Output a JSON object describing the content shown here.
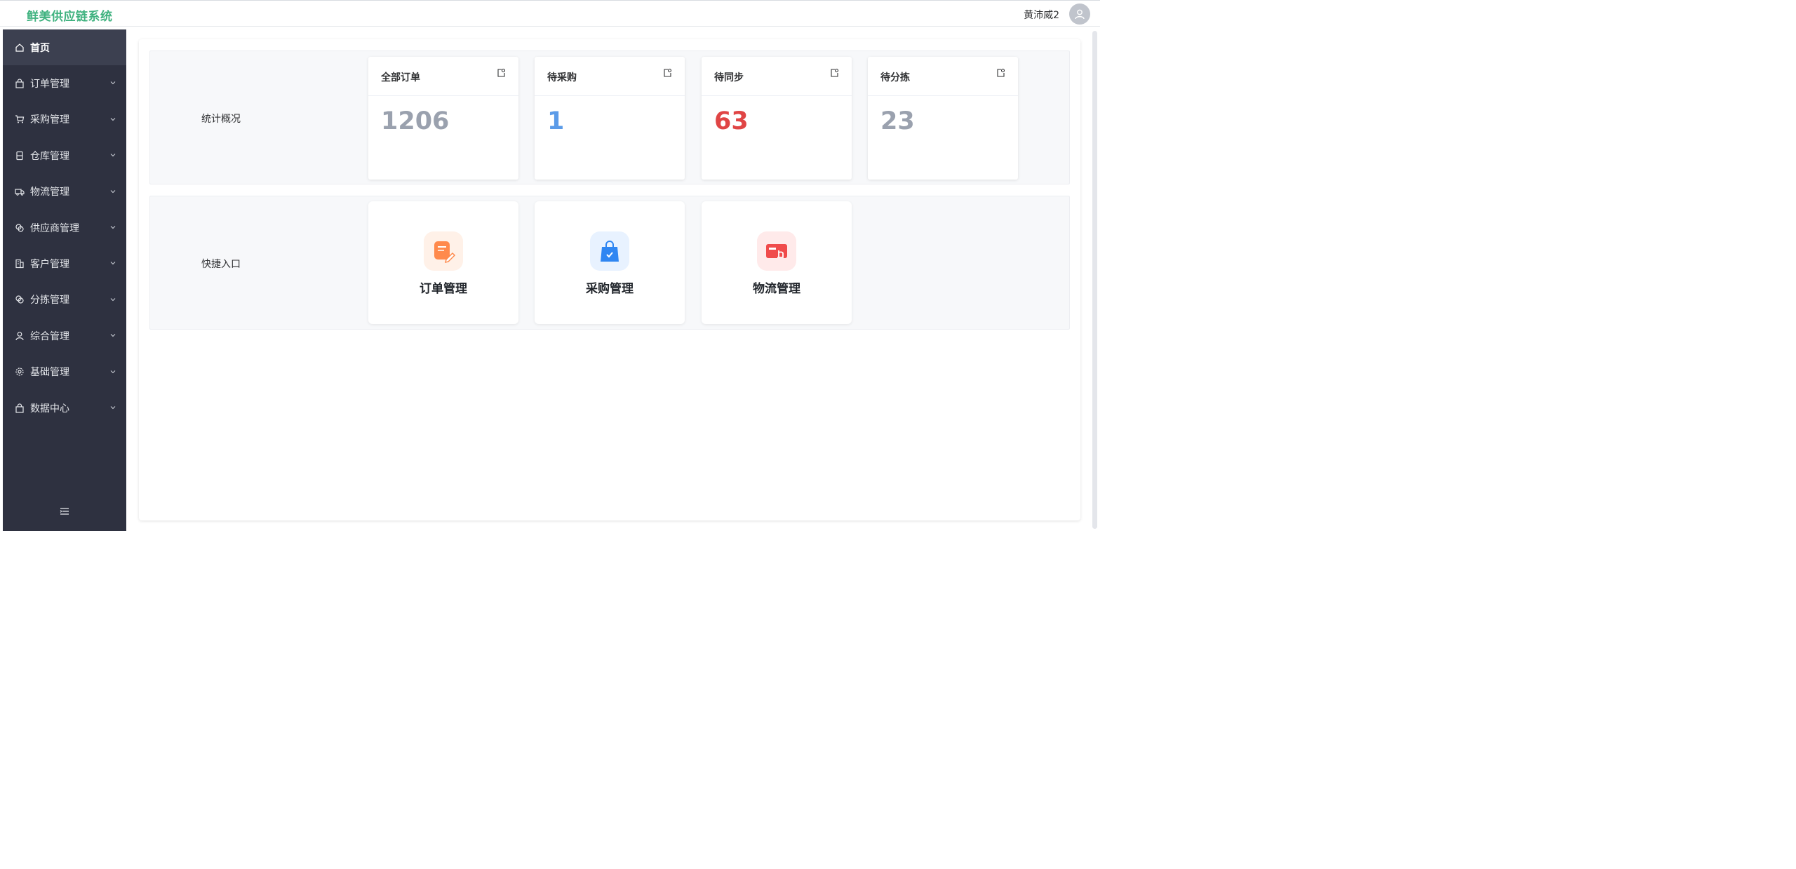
{
  "header": {
    "brand": "鲜美供应链系统",
    "username": "黄沛威2",
    "avatar_icon": "user-icon",
    "brand_color": "#3fb27f"
  },
  "sidebar": {
    "items": [
      {
        "label": "首页",
        "icon": "home-icon",
        "active": true
      },
      {
        "label": "订单管理",
        "icon": "bag-icon"
      },
      {
        "label": "采购管理",
        "icon": "cart-icon"
      },
      {
        "label": "仓库管理",
        "icon": "box-icon"
      },
      {
        "label": "物流管理",
        "icon": "truck-icon"
      },
      {
        "label": "供应商管理",
        "icon": "link-icon"
      },
      {
        "label": "客户管理",
        "icon": "office-icon"
      },
      {
        "label": "分拣管理",
        "icon": "link-icon"
      },
      {
        "label": "综合管理",
        "icon": "user-icon"
      },
      {
        "label": "基础管理",
        "icon": "gear-icon"
      },
      {
        "label": "数据中心",
        "icon": "bag-icon"
      }
    ],
    "collapse_icon": "fold-icon"
  },
  "stats": {
    "label": "统计概况",
    "cards": [
      {
        "title": "全部订单",
        "value": "1206",
        "color": "#9aa1ae"
      },
      {
        "title": "待采购",
        "value": "1",
        "color": "#5b9be8"
      },
      {
        "title": "待同步",
        "value": "63",
        "color": "#e04545"
      },
      {
        "title": "待分拣",
        "value": "23",
        "color": "#9aa1ae"
      }
    ]
  },
  "quick": {
    "label": "快捷入口",
    "cards": [
      {
        "label": "订单管理",
        "icon": "order-edit-icon",
        "bg": "#fff1e8"
      },
      {
        "label": "采购管理",
        "icon": "shopping-bag-icon",
        "bg": "#e8f2ff"
      },
      {
        "label": "物流管理",
        "icon": "card-tap-icon",
        "bg": "#ffeaea"
      }
    ]
  }
}
